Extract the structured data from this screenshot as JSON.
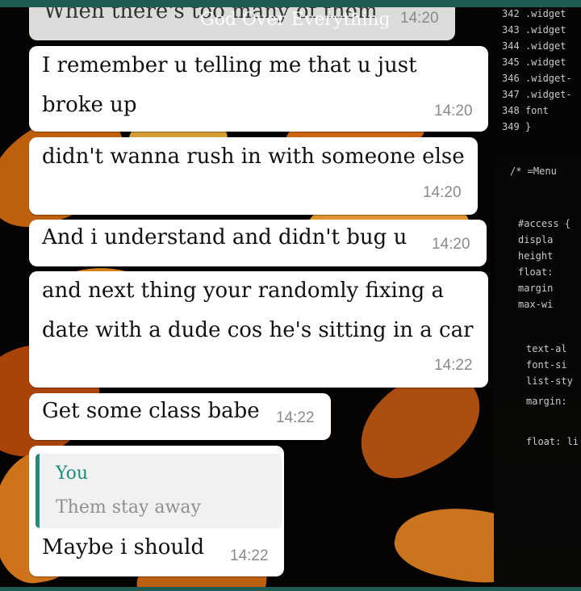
{
  "conversation": {
    "overlay_title": "God Over Everything",
    "messages": [
      {
        "text": "When there's too many of them",
        "time": "14:20"
      },
      {
        "text": "I remember u telling me that u just\nbroke up",
        "time": "14:20"
      },
      {
        "text": "didn't wanna rush in with someone else",
        "time": "14:20"
      },
      {
        "text": "And i understand and didn't bug u",
        "time": "14:20"
      },
      {
        "text": "and next thing your randomly fixing a\ndate with a dude cos he's sitting in a car",
        "time": "14:22"
      },
      {
        "text": "Get some class babe",
        "time": "14:22"
      },
      {
        "text": "Maybe i should",
        "time": "14:22",
        "quoted": {
          "author": "You",
          "text": "Them stay away"
        }
      }
    ]
  },
  "wallpaper_code": {
    "lines": [
      "342  .widget",
      "343  .widget",
      "344  .widget",
      "345  .widget",
      "346  .widget-",
      "347  .widget-",
      "348      font",
      "349  }",
      "/* =Menu",
      "#access {",
      "  displa",
      "  height",
      "  float:",
      "  margin",
      "  max-wi",
      "  text-al",
      "  font-si",
      "  list-sty",
      "  margin:",
      "  float: li"
    ]
  },
  "colors": {
    "accent": "#1f5b54",
    "quote_author": "#1f8c7d",
    "bubble": "#ffffff",
    "timestamp": "#8a8a8a"
  }
}
